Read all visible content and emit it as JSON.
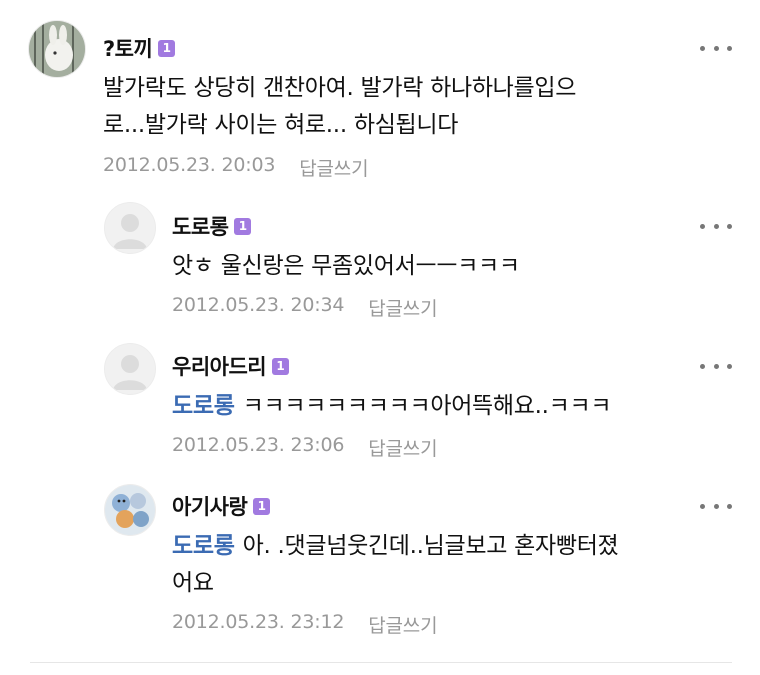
{
  "comments": [
    {
      "nickname": "?토끼",
      "badge": "1",
      "avatar_icon": "rabbit-photo-avatar",
      "text": "발가락도 상당히 갠찬아여. 발가락 하나하나를입으로...발가락 사이는 혀로... 하심됩니다",
      "text_lines": [
        "발가락도 상당히 갠찬아여. 발가락 하나하나를입으",
        "로...발가락 사이는 혀로... 하심됩니다"
      ],
      "date": "2012.05.23. 20:03",
      "reply_label": "답글쓰기"
    },
    {
      "nickname": "도로롱",
      "badge": "1",
      "avatar_icon": "default-profile-avatar",
      "text": "앗ㅎ 울신랑은 무좀있어서ㅡㅡㅋㅋㅋ",
      "date": "2012.05.23. 20:34",
      "reply_label": "답글쓰기"
    },
    {
      "nickname": "우리아드리",
      "badge": "1",
      "avatar_icon": "default-profile-avatar",
      "mention": "도로롱",
      "text": "ㅋㅋㅋㅋㅋㅋㅋㅋㅋ아어뜩해요..ㅋㅋㅋ",
      "date": "2012.05.23. 23:06",
      "reply_label": "답글쓰기"
    },
    {
      "nickname": "아기사랑",
      "badge": "1",
      "avatar_icon": "toys-photo-avatar",
      "mention": "도로롱",
      "text_lines": [
        "아. .댓글넘웃긴데..님글보고 혼자빵터졌",
        "어요"
      ],
      "date": "2012.05.23. 23:12",
      "reply_label": "답글쓰기"
    }
  ],
  "more_icon": "more-options-icon"
}
